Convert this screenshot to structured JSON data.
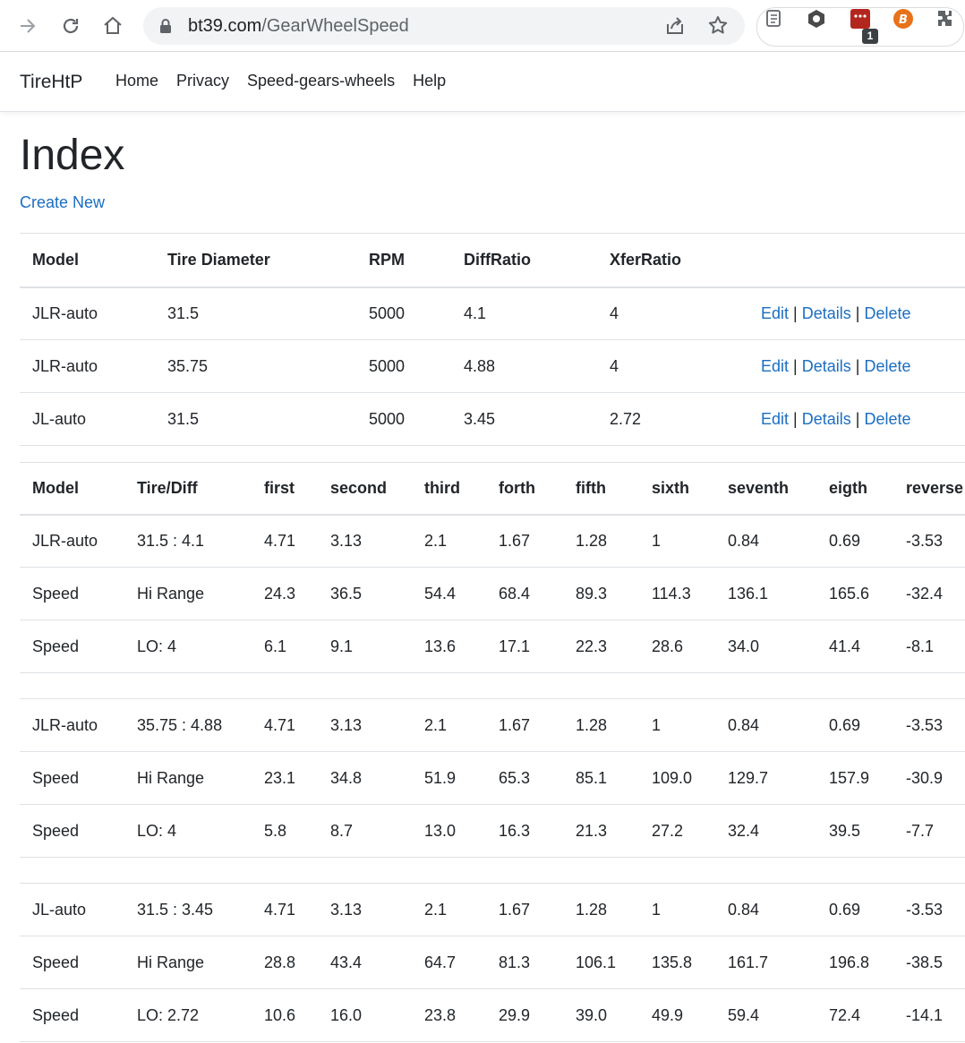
{
  "browser": {
    "url_domain": "bt39.com",
    "url_path": "/GearWheelSpeed",
    "ext_badge": "1"
  },
  "navbar": {
    "brand": "TireHtP",
    "links": [
      "Home",
      "Privacy",
      "Speed-gears-wheels",
      "Help"
    ]
  },
  "page": {
    "title": "Index",
    "create_new": "Create New"
  },
  "models_table": {
    "headers": [
      "Model",
      "Tire Diameter",
      "RPM",
      "DiffRatio",
      "XferRatio"
    ],
    "rows": [
      {
        "model": "JLR-auto",
        "tire": "31.5",
        "rpm": "5000",
        "diff": "4.1",
        "xfer": "4"
      },
      {
        "model": "JLR-auto",
        "tire": "35.75",
        "rpm": "5000",
        "diff": "4.88",
        "xfer": "4"
      },
      {
        "model": "JL-auto",
        "tire": "31.5",
        "rpm": "5000",
        "diff": "3.45",
        "xfer": "2.72"
      }
    ],
    "actions": {
      "edit": "Edit",
      "details": "Details",
      "delete": "Delete",
      "sep": "|"
    }
  },
  "speed_table": {
    "headers": [
      "Model",
      "Tire/Diff",
      "first",
      "second",
      "third",
      "forth",
      "fifth",
      "sixth",
      "seventh",
      "eigth",
      "reverse"
    ],
    "groups": [
      [
        [
          "JLR-auto",
          "31.5 : 4.1",
          "4.71",
          "3.13",
          "2.1",
          "1.67",
          "1.28",
          "1",
          "0.84",
          "0.69",
          "-3.53"
        ],
        [
          "Speed",
          "Hi Range",
          "24.3",
          "36.5",
          "54.4",
          "68.4",
          "89.3",
          "114.3",
          "136.1",
          "165.6",
          "-32.4"
        ],
        [
          "Speed",
          "LO: 4",
          "6.1",
          "9.1",
          "13.6",
          "17.1",
          "22.3",
          "28.6",
          "34.0",
          "41.4",
          "-8.1"
        ]
      ],
      [
        [
          "JLR-auto",
          "35.75 : 4.88",
          "4.71",
          "3.13",
          "2.1",
          "1.67",
          "1.28",
          "1",
          "0.84",
          "0.69",
          "-3.53"
        ],
        [
          "Speed",
          "Hi Range",
          "23.1",
          "34.8",
          "51.9",
          "65.3",
          "85.1",
          "109.0",
          "129.7",
          "157.9",
          "-30.9"
        ],
        [
          "Speed",
          "LO: 4",
          "5.8",
          "8.7",
          "13.0",
          "16.3",
          "21.3",
          "27.2",
          "32.4",
          "39.5",
          "-7.7"
        ]
      ],
      [
        [
          "JL-auto",
          "31.5 : 3.45",
          "4.71",
          "3.13",
          "2.1",
          "1.67",
          "1.28",
          "1",
          "0.84",
          "0.69",
          "-3.53"
        ],
        [
          "Speed",
          "Hi Range",
          "28.8",
          "43.4",
          "64.7",
          "81.3",
          "106.1",
          "135.8",
          "161.7",
          "196.8",
          "-38.5"
        ],
        [
          "Speed",
          "LO: 2.72",
          "10.6",
          "16.0",
          "23.8",
          "29.9",
          "39.0",
          "49.9",
          "59.4",
          "72.4",
          "-14.1"
        ]
      ]
    ]
  }
}
